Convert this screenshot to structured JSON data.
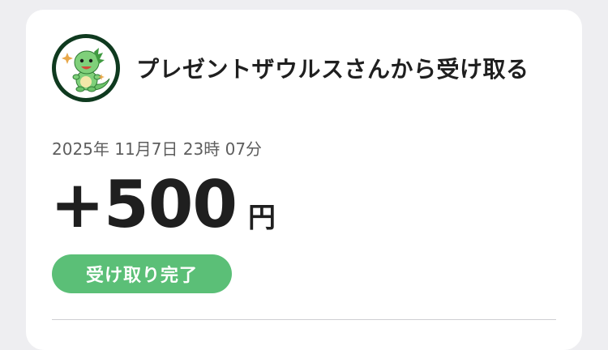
{
  "sender": {
    "title": "プレゼントザウルスさんから受け取る",
    "avatar_icon": "dinosaur-mascot-icon"
  },
  "transaction": {
    "datetime": "2025年 11月7日 23時 07分",
    "amount": "+500",
    "unit": "円",
    "status": "受け取り完了"
  },
  "colors": {
    "status_badge": "#5bbf77",
    "avatar_ring": "#0f3a1f",
    "background": "#eeeef1"
  }
}
